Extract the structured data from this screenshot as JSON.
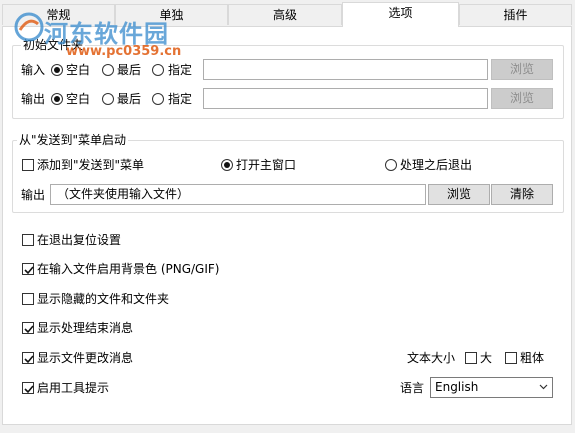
{
  "tabs": [
    {
      "label": "常规"
    },
    {
      "label": "单独"
    },
    {
      "label": "高级"
    },
    {
      "label": "选项"
    },
    {
      "label": "插件"
    }
  ],
  "watermark": {
    "text": "河东软件园",
    "url": "www.pc0359.cn"
  },
  "initial_folder": {
    "title": "初始文件夹",
    "input": {
      "label": "输入",
      "opt_empty": "空白",
      "opt_last": "最后",
      "opt_specify": "指定",
      "value": "",
      "browse": "浏览"
    },
    "output": {
      "label": "输出",
      "opt_empty": "空白",
      "opt_last": "最后",
      "opt_specify": "指定",
      "value": "",
      "browse": "浏览"
    }
  },
  "sendto": {
    "title": "从\"发送到\"菜单启动",
    "add_label": "添加到\"发送到\"菜单",
    "open_main": "打开主窗口",
    "exit_after": "处理之后退出",
    "output_label": "输出",
    "output_value": "（文件夹使用输入文件）",
    "browse": "浏览",
    "clear": "清除"
  },
  "options": {
    "reset_on_exit": "在退出复位设置",
    "enable_bg": "在输入文件启用背景色 (PNG/GIF)",
    "show_hidden": "显示隐藏的文件和文件夹",
    "show_done_msg": "显示处理结束消息",
    "show_change_msg": "显示文件更改消息",
    "enable_tooltip": "启用工具提示"
  },
  "text_size": {
    "label": "文本大小",
    "large": "大",
    "bold": "粗体"
  },
  "language": {
    "label": "语言",
    "value": "English"
  }
}
